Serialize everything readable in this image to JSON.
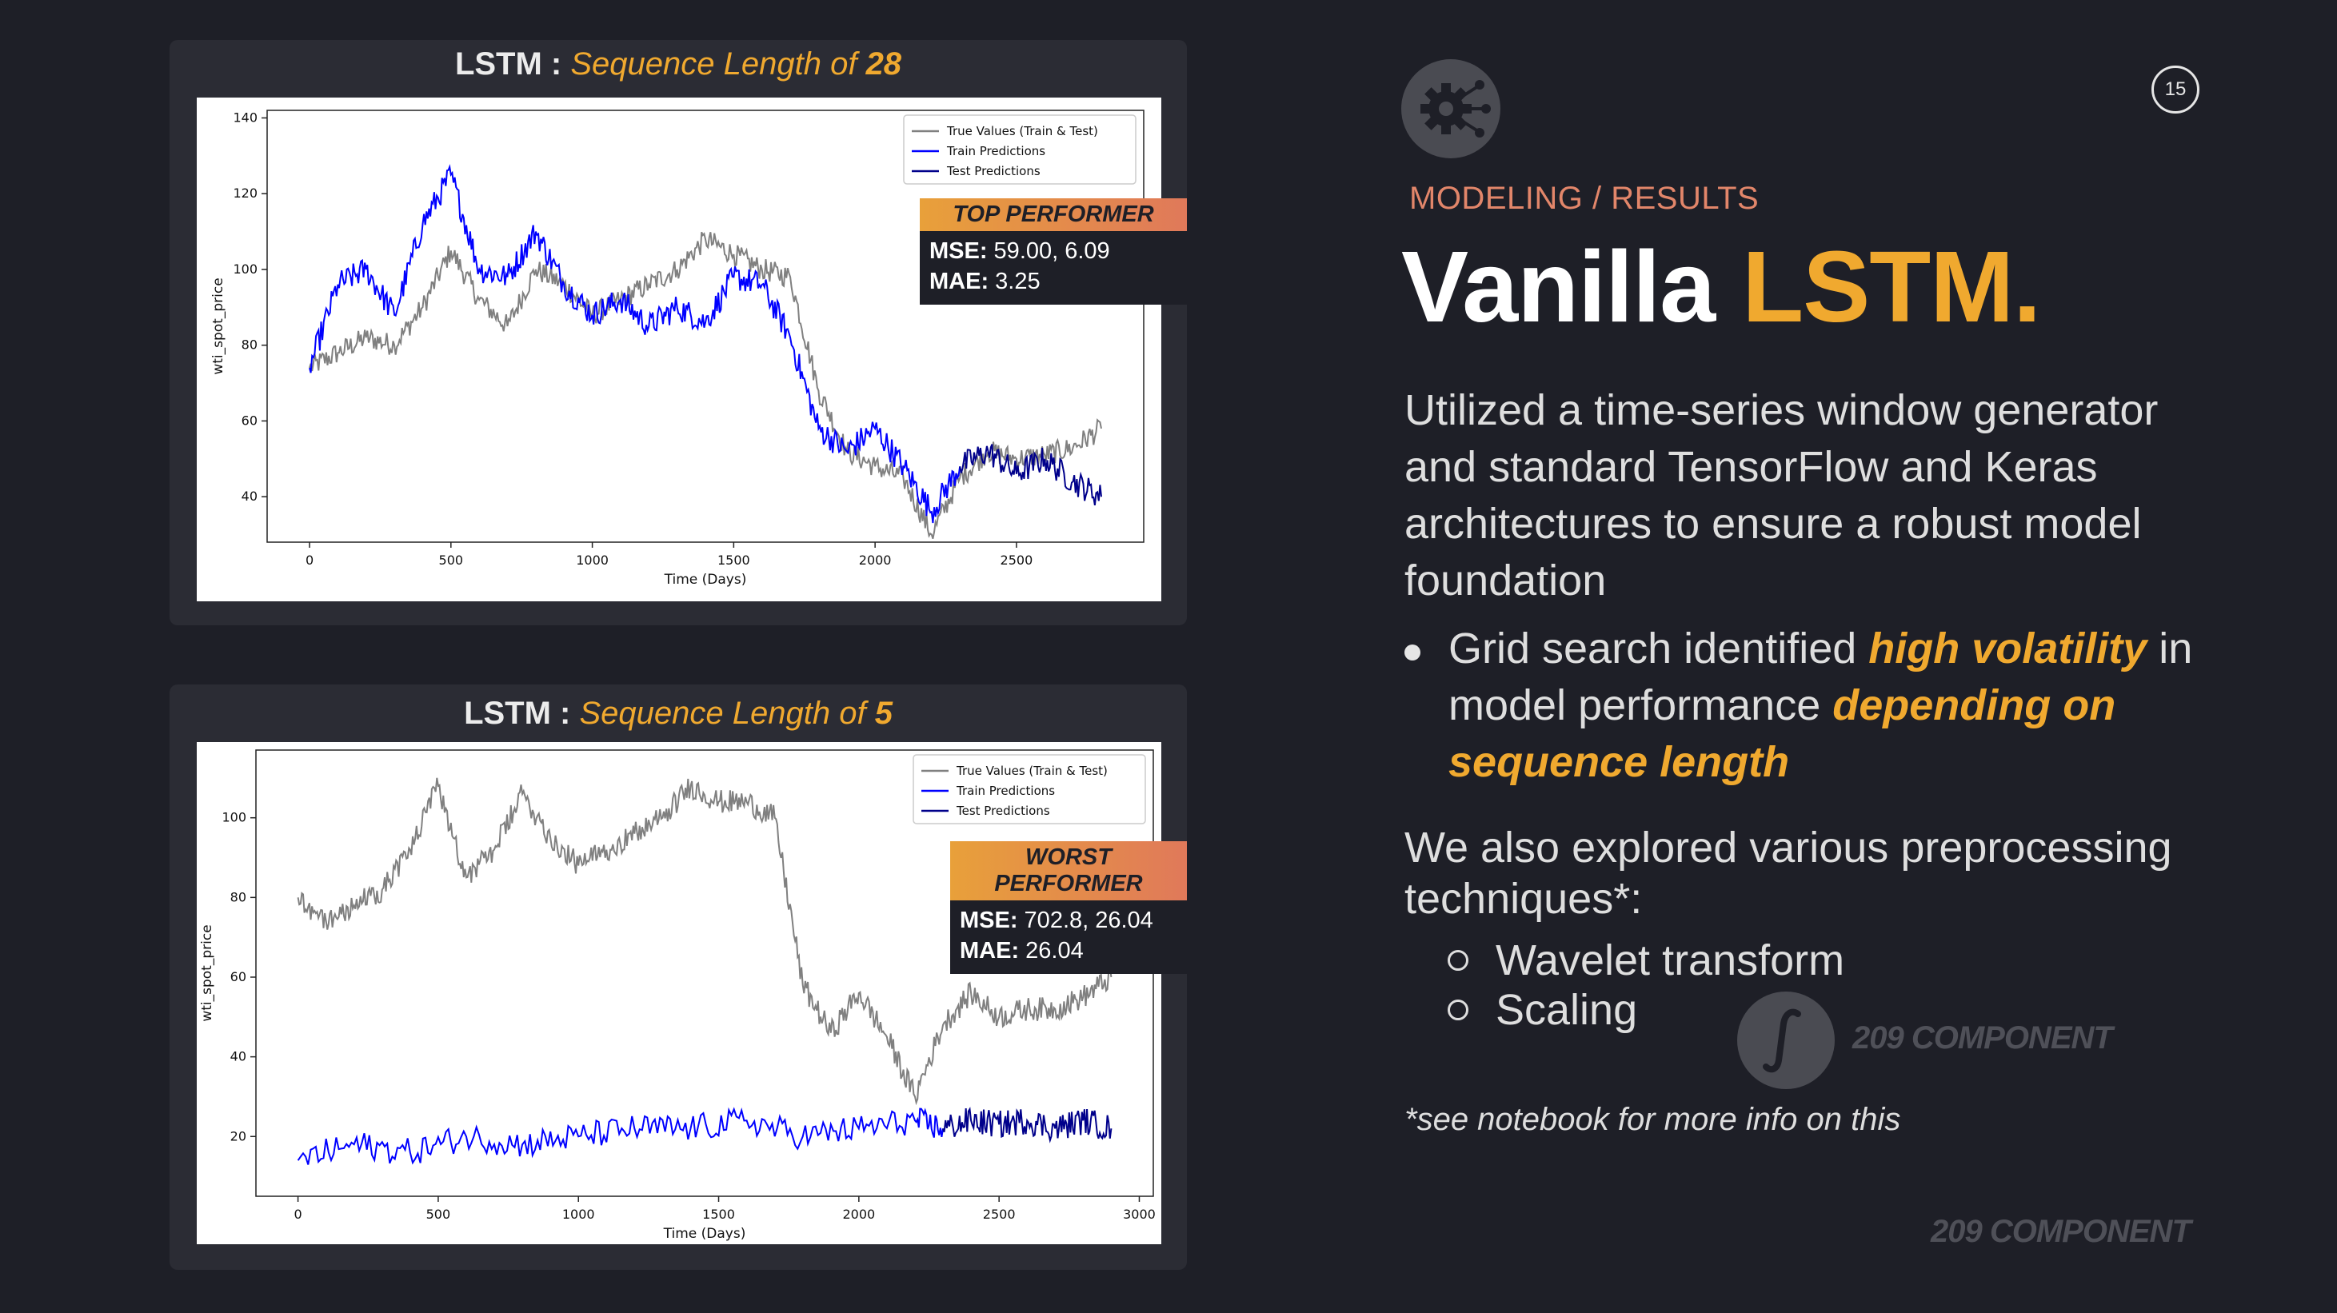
{
  "top_panel": {
    "title_prefix": "LSTM : ",
    "title_italic": "Sequence Length of ",
    "title_num": "28",
    "badge": {
      "head": "TOP PERFORMER",
      "mse_label": "MSE:",
      "mse_value": " 59.00, 6.09",
      "mae_label": "MAE:",
      "mae_value": " 3.25"
    }
  },
  "bottom_panel": {
    "title_prefix": "LSTM : ",
    "title_italic": "Sequence Length of ",
    "title_num": "5",
    "badge": {
      "head": "WORST PERFORMER",
      "mse_label": "MSE:",
      "mse_value": " 702.8, 26.04",
      "mae_label": "MAE:",
      "mae_value": " 26.04"
    }
  },
  "chart_data": [
    {
      "type": "line",
      "xlabel": "Time (Days)",
      "ylabel": "wti_spot_price",
      "xlim": [
        -150,
        2950
      ],
      "ylim": [
        28,
        142
      ],
      "xticks": [
        0,
        500,
        1000,
        1500,
        2000,
        2500
      ],
      "yticks": [
        40,
        60,
        80,
        100,
        120,
        140
      ],
      "legend_position": "top-right",
      "series": [
        {
          "name": "True Values (Train & Test)",
          "color": "#808080",
          "x": [
            0,
            100,
            200,
            300,
            400,
            500,
            600,
            700,
            800,
            900,
            1000,
            1100,
            1200,
            1300,
            1400,
            1500,
            1600,
            1700,
            1800,
            1900,
            2000,
            2100,
            2200,
            2300,
            2400,
            2500,
            2600,
            2700,
            2800
          ],
          "y": [
            74,
            78,
            82,
            80,
            90,
            105,
            92,
            85,
            100,
            96,
            88,
            92,
            96,
            100,
            108,
            104,
            100,
            98,
            68,
            52,
            48,
            45,
            30,
            45,
            52,
            50,
            51,
            53,
            58
          ]
        },
        {
          "name": "Train Predictions",
          "color": "#0000ff",
          "x": [
            0,
            100,
            200,
            300,
            400,
            500,
            600,
            700,
            800,
            900,
            1000,
            1100,
            1200,
            1300,
            1400,
            1500,
            1600,
            1700,
            1800,
            1900,
            2000,
            2100,
            2200,
            2300
          ],
          "y": [
            74,
            96,
            100,
            88,
            112,
            125,
            100,
            98,
            110,
            96,
            88,
            92,
            85,
            90,
            86,
            98,
            96,
            82,
            58,
            52,
            58,
            48,
            36,
            48
          ]
        },
        {
          "name": "Test Predictions",
          "color": "#00008b",
          "x": [
            2300,
            2400,
            2500,
            2600,
            2700,
            2800
          ],
          "y": [
            48,
            52,
            46,
            50,
            44,
            40
          ]
        }
      ]
    },
    {
      "type": "line",
      "xlabel": "Time (Days)",
      "ylabel": "wti_spot_price",
      "xlim": [
        -150,
        3050
      ],
      "ylim": [
        5,
        117
      ],
      "xticks": [
        0,
        500,
        1000,
        1500,
        2000,
        2500,
        3000
      ],
      "yticks": [
        20,
        40,
        60,
        80,
        100
      ],
      "legend_position": "top-right",
      "series": [
        {
          "name": "True Values (Train & Test)",
          "color": "#808080",
          "x": [
            0,
            100,
            200,
            300,
            400,
            500,
            600,
            700,
            800,
            900,
            1000,
            1100,
            1200,
            1300,
            1400,
            1500,
            1600,
            1700,
            1800,
            1900,
            2000,
            2100,
            2200,
            2300,
            2400,
            2500,
            2600,
            2700,
            2800,
            2900
          ],
          "y": [
            80,
            74,
            78,
            82,
            92,
            108,
            85,
            92,
            106,
            95,
            88,
            92,
            96,
            100,
            108,
            104,
            104,
            100,
            58,
            46,
            56,
            45,
            30,
            48,
            56,
            50,
            52,
            52,
            55,
            60
          ]
        },
        {
          "name": "Train Predictions",
          "color": "#0000ff",
          "x": [
            0,
            200,
            400,
            600,
            800,
            1000,
            1200,
            1400,
            1600,
            1800,
            2000,
            2200,
            2300
          ],
          "y": [
            14,
            18,
            16,
            20,
            18,
            20,
            22,
            22,
            24,
            20,
            22,
            24,
            22
          ]
        },
        {
          "name": "Test Predictions",
          "color": "#00008b",
          "x": [
            2300,
            2400,
            2500,
            2600,
            2700,
            2800,
            2900
          ],
          "y": [
            22,
            24,
            23,
            24,
            22,
            24,
            22
          ]
        }
      ]
    }
  ],
  "slide": {
    "page_number": "15",
    "section": "MODELING / RESULTS",
    "title_white": "Vanilla ",
    "title_accent": "LSTM.",
    "paragraph": "Utilized a time-series window generator and standard TensorFlow and Keras architectures to ensure a robust model foundation",
    "bullet": {
      "t1": "Grid search identified ",
      "h1": "high volatility",
      "t2": " in model performance ",
      "h2": "depending on sequence length"
    },
    "explored": "We also explored various preprocessing techniques*:",
    "subitems": [
      "Wavelet transform",
      "Scaling"
    ],
    "note": "*see notebook for more info on this",
    "watermark_1": "209 COMPONENT",
    "watermark_2": "209 COMPONENT",
    "icons": {
      "section": "gear-cog-icon",
      "watermark": "integral-logo-icon"
    },
    "colors": {
      "accent": "#f0a92f",
      "section": "#e2866a",
      "background": "#1e1f27"
    }
  }
}
